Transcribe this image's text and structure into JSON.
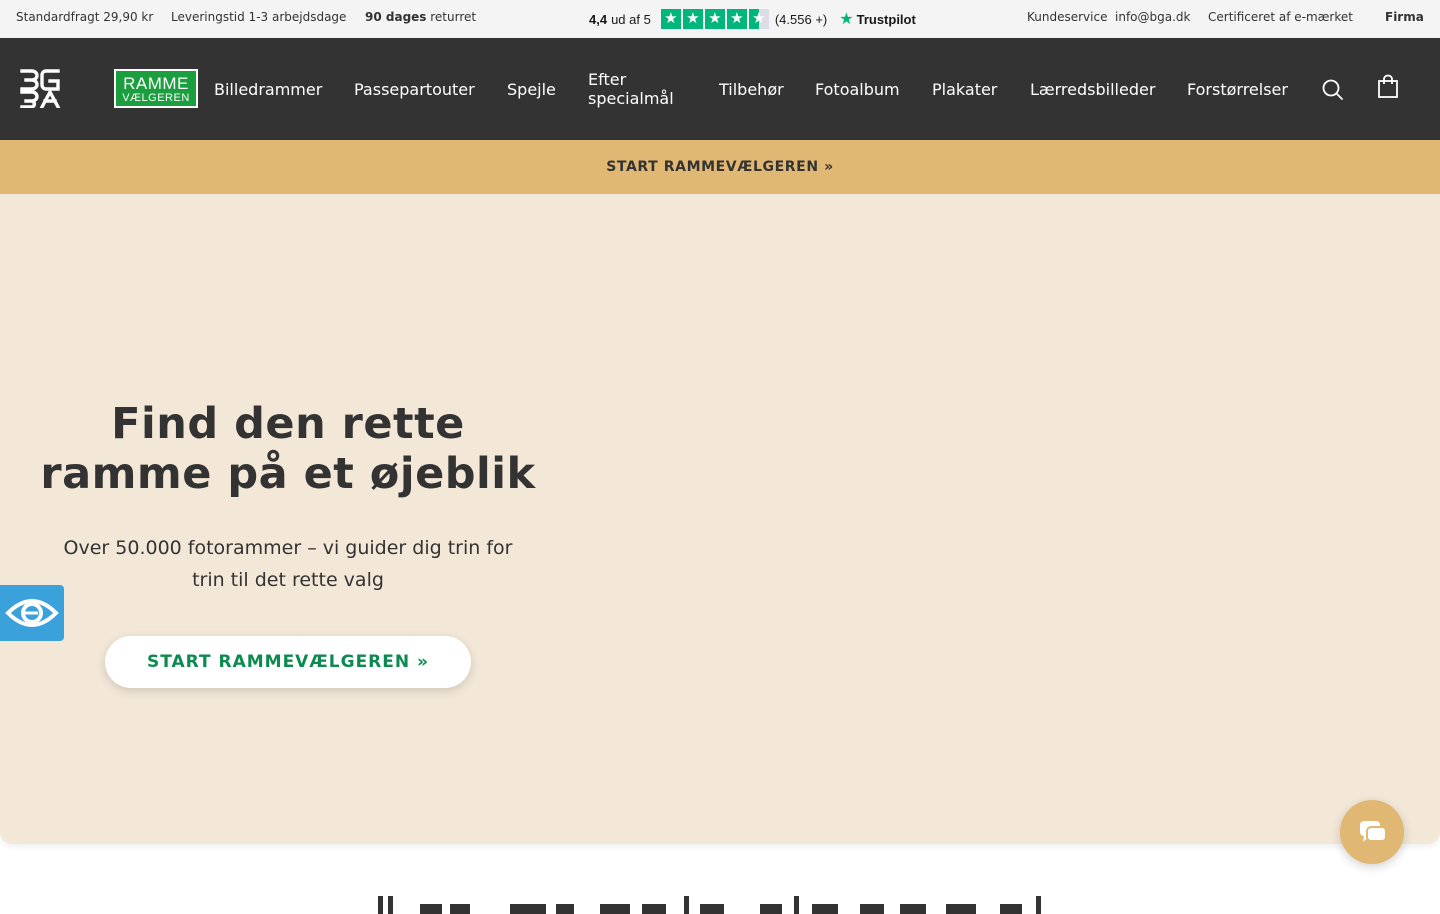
{
  "topbar": {
    "shipping": "Standardfragt 29,90 kr",
    "delivery": "Leveringstid 1-3 arbejdsdage",
    "returns_bold": "90 dages",
    "returns_rest": " returret",
    "trustpilot": {
      "score": "4,4",
      "score_suffix": "ud af 5",
      "count": "(4.556 +)",
      "brand": "Trustpilot",
      "rating": 4.4
    },
    "customer_service": "Kundeservice",
    "email": "info@bga.dk",
    "certified": "Certificeret af e-mærket",
    "business": "Firma"
  },
  "header": {
    "logo_rv_line1": "RAMME",
    "logo_rv_line2": "VÆLGEREN",
    "nav": [
      {
        "label": "Billedrammer"
      },
      {
        "label": "Passepartouter"
      },
      {
        "label": "Spejle"
      },
      {
        "label_line1": "Efter",
        "label_line2": "specialmål"
      },
      {
        "label": "Tilbehør"
      },
      {
        "label": "Fotoalbum"
      },
      {
        "label": "Plakater"
      },
      {
        "label": "Lærredsbilleder"
      },
      {
        "label": "Forstørrelser"
      }
    ],
    "icons": [
      "search-icon",
      "shopping-bag-icon"
    ]
  },
  "strip": {
    "label": "START RAMMEVÆLGEREN »"
  },
  "hero": {
    "title_line1": "Find den rette",
    "title_line2": "ramme på et øjeblik",
    "subtitle_line1": "Over 50.000 fotorammer – vi guider dig trin for",
    "subtitle_line2": "trin til det rette valg",
    "cta": "START RAMMEVÆLGEREN »"
  },
  "colors": {
    "topbar_bg": "#f4f4f4",
    "header_bg": "#333333",
    "strip_bg": "#e0b873",
    "hero_bg": "#f3e8d8",
    "cta_text": "#0d8a4f",
    "trustpilot_green": "#00b67a",
    "accessibility_blue": "#3ba1da",
    "rammevaelgeren_green": "#1a9e3e"
  },
  "widgets": [
    "accessibility-eye-icon",
    "chat-icon"
  ]
}
